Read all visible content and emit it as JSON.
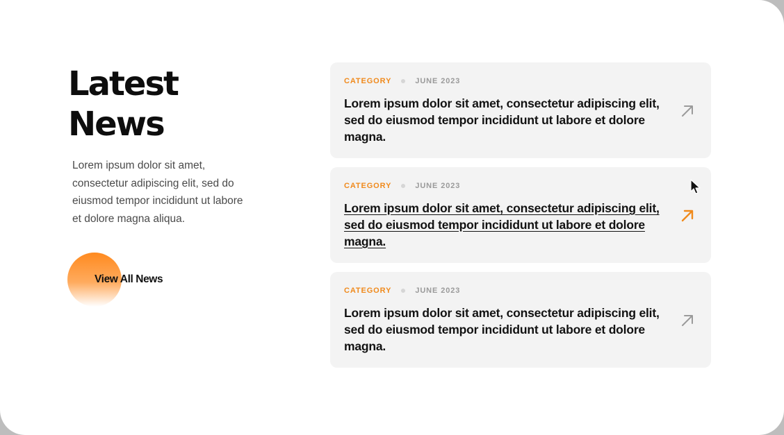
{
  "section": {
    "title_line1": "Latest",
    "title_line2": "News",
    "description": "Lorem ipsum dolor sit amet, consectetur adipiscing elit, sed do eiusmod tempor incididunt ut labore et dolore magna aliqua.",
    "view_all_label": "View All News"
  },
  "colors": {
    "accent": "#f08a1c",
    "card_bg": "#f3f3f3",
    "arrow_idle": "#9a9a9a"
  },
  "news": [
    {
      "category": "CATEGORY",
      "date": "JUNE 2023",
      "title": "Lorem ipsum dolor sit amet, consectetur adipiscing elit, sed do eiusmod tempor incididunt ut labore et dolore magna.",
      "icon": "arrow-up-right-icon",
      "hovered": false
    },
    {
      "category": "CATEGORY",
      "date": "JUNE 2023",
      "title": "Lorem ipsum dolor sit amet, consectetur adipiscing elit, sed do eiusmod tempor incididunt ut labore et dolore magna.",
      "icon": "arrow-up-right-icon",
      "hovered": true
    },
    {
      "category": "CATEGORY",
      "date": "JUNE 2023",
      "title": "Lorem ipsum dolor sit amet, consectetur adipiscing elit, sed do eiusmod tempor incididunt ut labore et dolore magna.",
      "icon": "arrow-up-right-icon",
      "hovered": false
    }
  ]
}
